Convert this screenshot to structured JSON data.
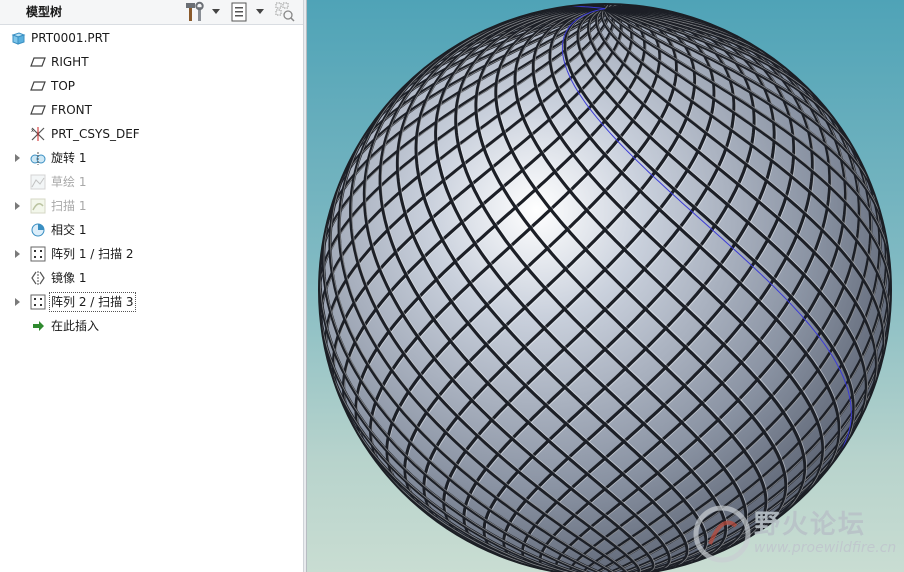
{
  "panel": {
    "title": "模型树",
    "tools_icon": "hammer-wrench-icon",
    "settings_icon": "list-settings-icon",
    "filter_icon": "show-filter-icon"
  },
  "tree": {
    "items": [
      {
        "label": "PRT0001.PRT",
        "icon": "part-icon",
        "expandable": false,
        "dimmed": false
      },
      {
        "label": "RIGHT",
        "icon": "datum-plane-icon",
        "expandable": false,
        "dimmed": false
      },
      {
        "label": "TOP",
        "icon": "datum-plane-icon",
        "expandable": false,
        "dimmed": false
      },
      {
        "label": "FRONT",
        "icon": "datum-plane-icon",
        "expandable": false,
        "dimmed": false
      },
      {
        "label": "PRT_CSYS_DEF",
        "icon": "coordinate-system-icon",
        "expandable": false,
        "dimmed": false
      },
      {
        "label": "旋转 1",
        "icon": "revolve-icon",
        "expandable": true,
        "dimmed": false
      },
      {
        "label": "草绘 1",
        "icon": "sketch-icon",
        "expandable": false,
        "dimmed": true
      },
      {
        "label": "扫描 1",
        "icon": "sweep-icon",
        "expandable": true,
        "dimmed": true
      },
      {
        "label": "相交 1",
        "icon": "intersect-icon",
        "expandable": false,
        "dimmed": false
      },
      {
        "label": "阵列 1 / 扫描 2",
        "icon": "pattern-icon",
        "expandable": true,
        "dimmed": false
      },
      {
        "label": "镜像 1",
        "icon": "mirror-icon",
        "expandable": false,
        "dimmed": false
      },
      {
        "label": "阵列 2 / 扫描 3",
        "icon": "pattern-icon",
        "expandable": true,
        "dimmed": false,
        "focused": true
      },
      {
        "label": "在此插入",
        "icon": "insert-here-arrow-icon",
        "expandable": false,
        "dimmed": false
      }
    ]
  },
  "viewport": {
    "model": "lattice-sphere",
    "background_top": "#4fa3b7",
    "background_bottom": "#c9ddd2"
  },
  "watermark": {
    "title": "野火论坛",
    "url": "www.proewildfire.cn"
  }
}
